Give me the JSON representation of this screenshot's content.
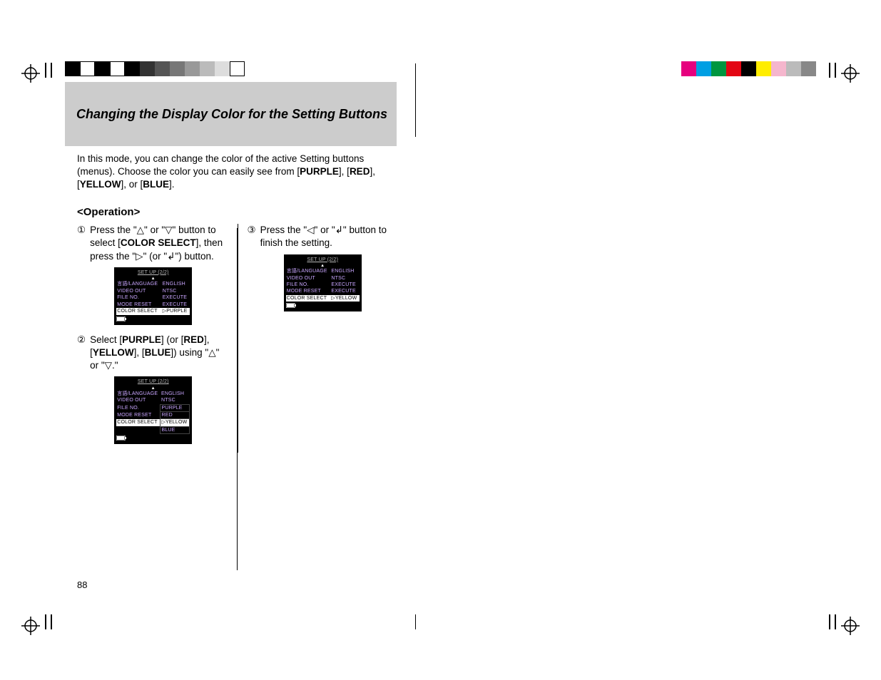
{
  "title": "Changing the Display Color for the Setting Buttons",
  "intro_before": "In this mode, you can change the color of the active Setting buttons (menus). Choose the color you can easily see from [",
  "c_purple": "PURPLE",
  "i_sep1": "], [",
  "c_red": "RED",
  "i_sep2": "], [",
  "c_yellow": "YELLOW",
  "i_sep3": "], or [",
  "c_blue": "BLUE",
  "i_end": "].",
  "operation": "<Operation>",
  "step1": {
    "num": "①",
    "t1": "Press the \"△\" or \"▽\" button to select [",
    "cs": "COLOR SELECT",
    "t2": "], then press the \"▷\" (or \"↲\") button."
  },
  "step2": {
    "num": "②",
    "t1": "Select [",
    "p": "PURPLE",
    "t2": "] (or [",
    "r": "RED",
    "t3": "], [",
    "y": "YELLOW",
    "t4": "], [",
    "b": "BLUE",
    "t5": "]) using \"△\" or \"▽.\""
  },
  "step3": {
    "num": "③",
    "t1": "Press the \"◁\" or \"↲\" button to finish the setting."
  },
  "lcd": {
    "header": "SET UP   (2/2)",
    "rows": [
      {
        "l": "言語/LANGUAGE",
        "v": "ENGLISH"
      },
      {
        "l": "VIDEO OUT",
        "v": "NTSC"
      },
      {
        "l": "FILE NO.",
        "v": "EXECUTE"
      },
      {
        "l": "MODE RESET",
        "v": "EXECUTE"
      },
      {
        "l": "COLOR SELECT",
        "v": "▷PURPLE"
      }
    ],
    "rows2": [
      {
        "l": "言語/LANGUAGE",
        "v": "ENGLISH"
      },
      {
        "l": "VIDEO OUT",
        "v": "NTSC"
      },
      {
        "l": "FILE NO.",
        "v": "PURPLE"
      },
      {
        "l": "MODE RESET",
        "v": "RED"
      },
      {
        "l": "COLOR SELECT",
        "v": "▷YELLOW"
      },
      {
        "l": "",
        "v": "BLUE"
      }
    ],
    "rows3": [
      {
        "l": "言語/LANGUAGE",
        "v": "ENGLISH"
      },
      {
        "l": "VIDEO OUT",
        "v": "NTSC"
      },
      {
        "l": "FILE NO.",
        "v": "EXECUTE"
      },
      {
        "l": "MODE RESET",
        "v": "EXECUTE"
      },
      {
        "l": "COLOR SELECT",
        "v": "▷YELLOW"
      }
    ]
  },
  "pagenum": "88",
  "colorbar_left": [
    "#000",
    "#fff",
    "#000",
    "#fff",
    "#000",
    "#333",
    "#555",
    "#777",
    "#999",
    "#bbb",
    "#ddd",
    "#fff"
  ],
  "colorbar_right": [
    "#e6007e",
    "#009fe3",
    "#009640",
    "#e30613",
    "#000",
    "#ffed00",
    "#f5b6cd",
    "#bbb",
    "#888"
  ]
}
